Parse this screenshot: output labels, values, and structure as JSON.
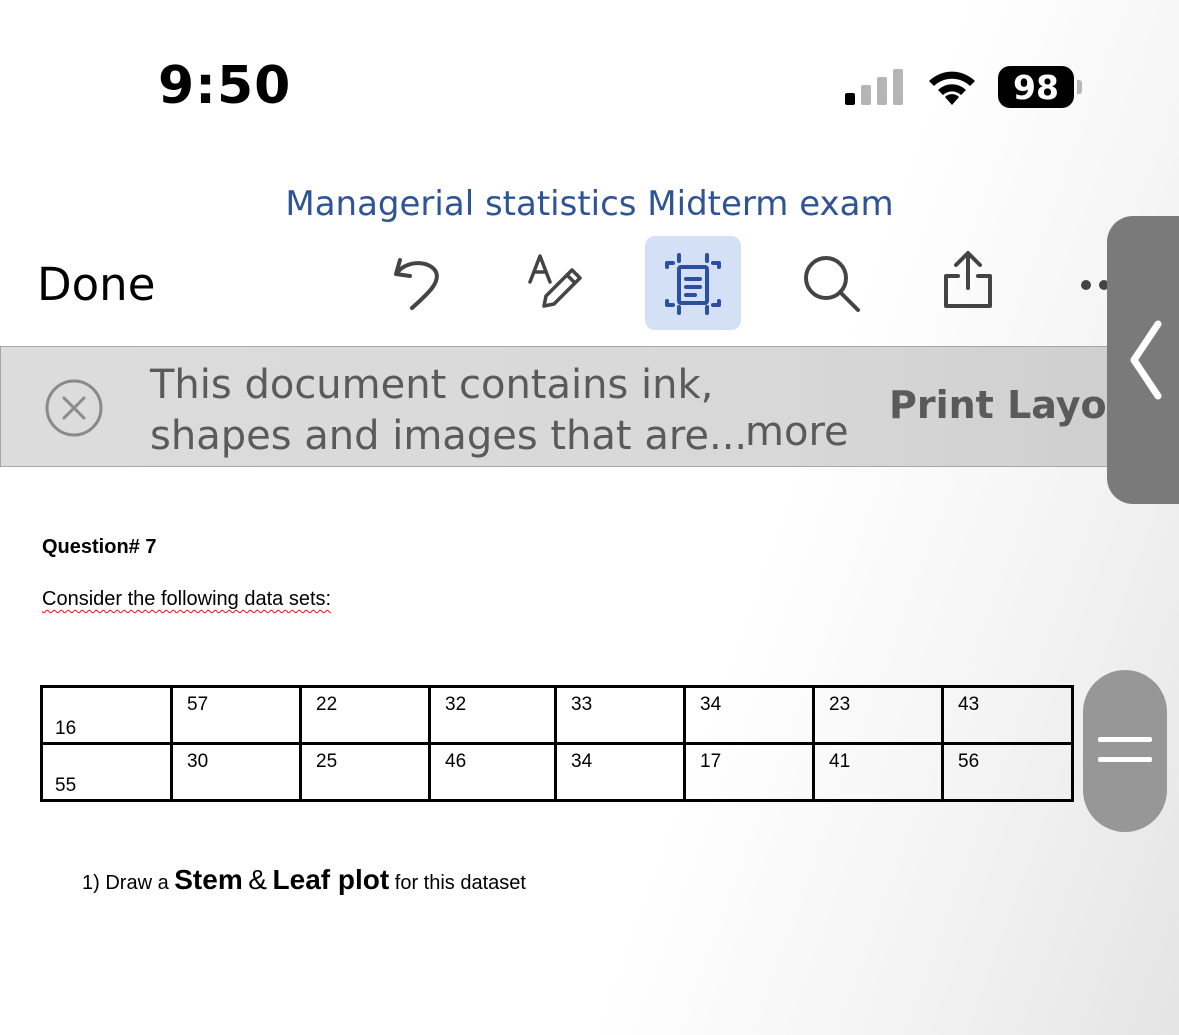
{
  "status_bar": {
    "time": "9:50",
    "battery": "98"
  },
  "document": {
    "title": "Managerial statistics Midterm exam"
  },
  "toolbar": {
    "done_label": "Done",
    "icons": [
      "undo-icon",
      "pen-format-icon",
      "focus-view-icon",
      "search-icon",
      "share-icon",
      "more-icon"
    ],
    "active_icon": "focus-view-icon"
  },
  "banner": {
    "line1": "This document contains ink,",
    "line2": "shapes and images that are...",
    "more_label": "more",
    "print_layout_label": "Print Layou"
  },
  "content": {
    "question_heading": "Question# 7",
    "intro": "Consider the following data sets:",
    "table_rows": [
      [
        "16",
        "57",
        "22",
        "32",
        "33",
        "34",
        "23",
        "43"
      ],
      [
        "55",
        "30",
        "25",
        "46",
        "34",
        "17",
        "41",
        "56"
      ]
    ],
    "task": {
      "prefix": "1) Draw a ",
      "stem": "Stem",
      "amp": "&",
      "leaf": "Leaf plot",
      "suffix": " for this dataset"
    }
  },
  "colors": {
    "title_blue": "#2f5496",
    "toolbar_blue": "#2b4fa2",
    "active_bg": "#d4e0f5",
    "banner_bg": "#d9d9d9",
    "banner_text": "#5a5a5a",
    "side_handle": "#7a7a7a"
  }
}
